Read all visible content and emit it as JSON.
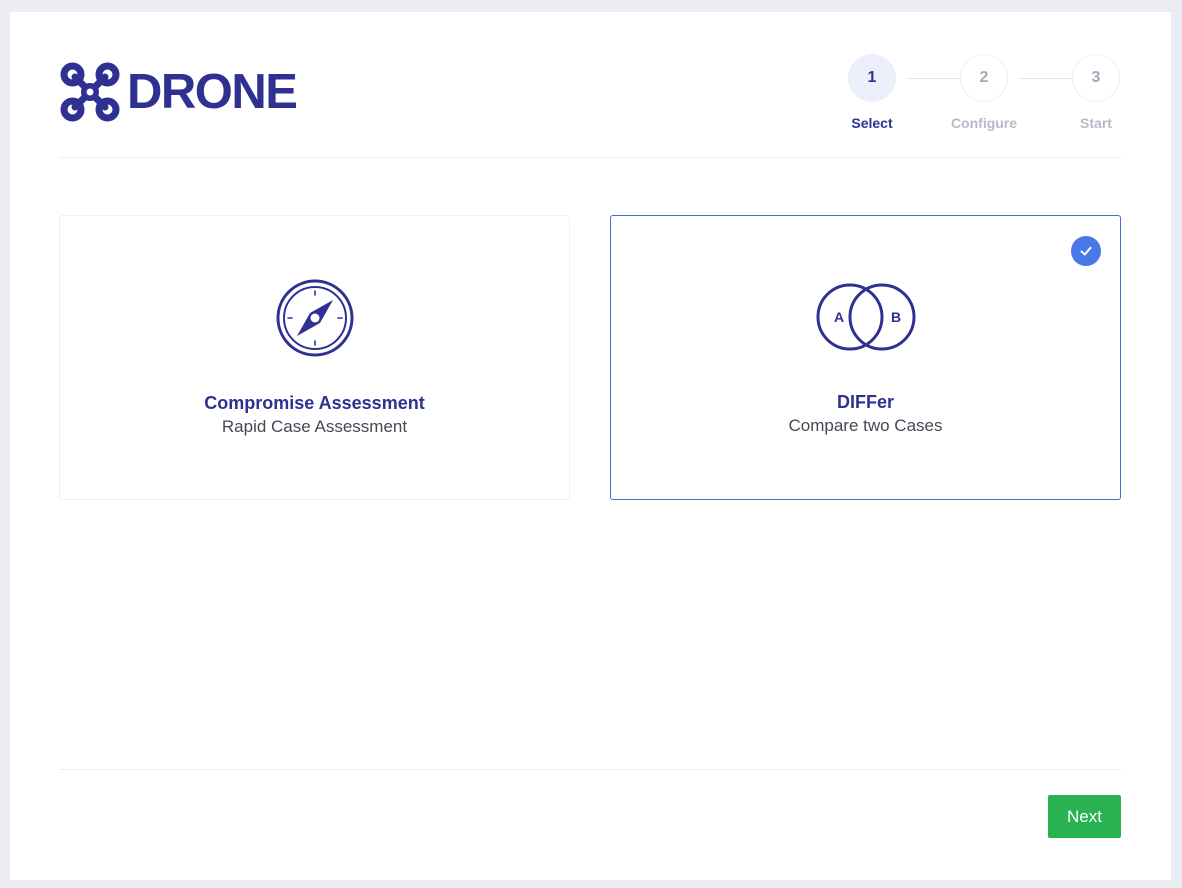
{
  "brand": {
    "name": "DRONE",
    "icon": "drone-icon",
    "color": "#2e3192"
  },
  "stepper": {
    "steps": [
      {
        "number": "1",
        "label": "Select",
        "state": "active"
      },
      {
        "number": "2",
        "label": "Configure",
        "state": "inactive"
      },
      {
        "number": "3",
        "label": "Start",
        "state": "inactive"
      }
    ]
  },
  "options": [
    {
      "title": "Compromise Assessment",
      "subtitle": "Rapid Case Assessment",
      "icon": "compass-icon",
      "selected": false
    },
    {
      "title": "DIFFer",
      "subtitle": "Compare two Cases",
      "icon": "venn-diagram-icon",
      "icon_labels": [
        "A",
        "B"
      ],
      "selected": true
    }
  ],
  "footer": {
    "next_label": "Next"
  },
  "colors": {
    "accent": "#2e3192",
    "selected_border": "#4a6bd4",
    "check_badge": "#4a78e8",
    "next_button": "#28b252"
  }
}
